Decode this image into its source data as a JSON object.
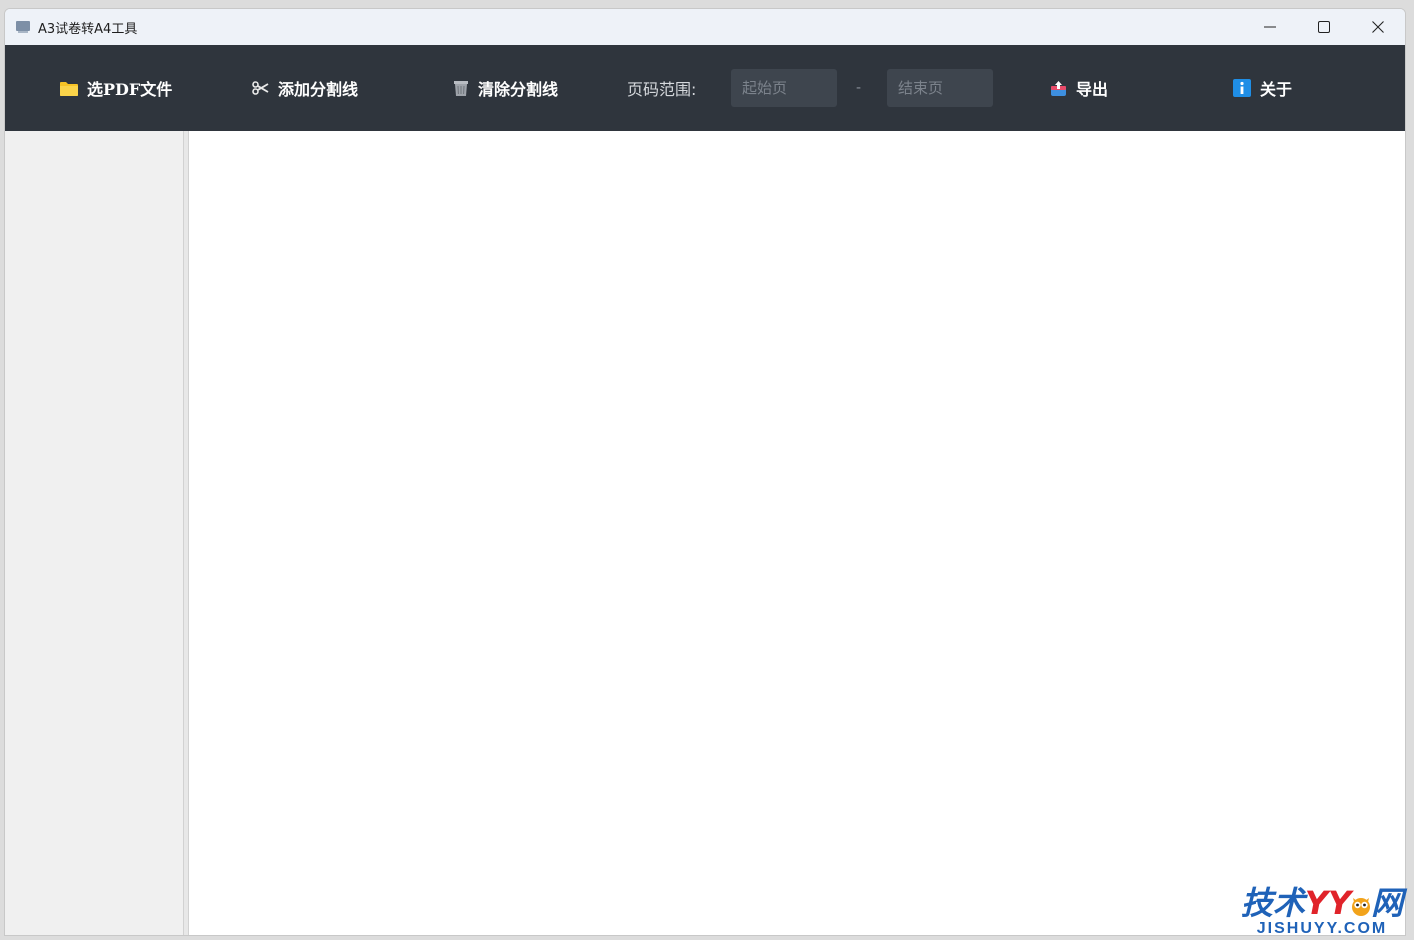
{
  "window": {
    "title": "A3试卷转A4工具"
  },
  "toolbar": {
    "open_pdf_label": "选PDF文件",
    "add_split_label": "添加分割线",
    "clear_split_label": "清除分割线",
    "page_range_label": "页码范围:",
    "start_page_placeholder": "起始页",
    "start_page_value": "",
    "range_separator": "-",
    "end_page_placeholder": "结束页",
    "end_page_value": "",
    "export_label": "导出",
    "about_label": "关于"
  },
  "icons": {
    "open_pdf": "folder-icon",
    "add_split": "scissors-icon",
    "clear_split": "trash-icon",
    "export": "export-box-icon",
    "about": "info-icon"
  },
  "colors": {
    "toolbar_bg": "#2f353d",
    "titlebar_bg": "#eef2f8",
    "sidebar_bg": "#f0f0f0",
    "folder": "#f7c326",
    "info": "#1f8ee6"
  },
  "watermark": {
    "top_part1": "技术",
    "top_part2": "YY",
    "top_part3": "网",
    "bottom": "JISHUYY.COM"
  }
}
